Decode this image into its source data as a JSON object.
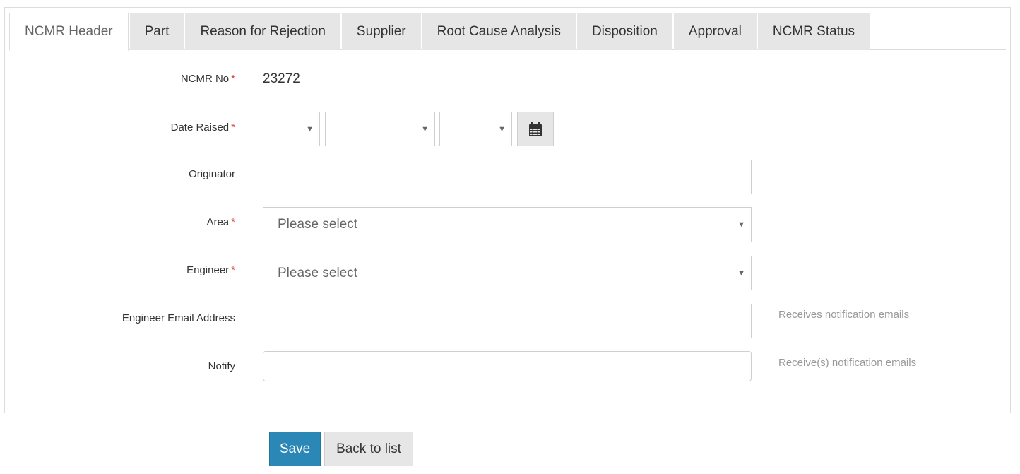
{
  "tabs": [
    {
      "label": "NCMR Header",
      "active": true
    },
    {
      "label": "Part"
    },
    {
      "label": "Reason for Rejection"
    },
    {
      "label": "Supplier"
    },
    {
      "label": "Root Cause Analysis"
    },
    {
      "label": "Disposition"
    },
    {
      "label": "Approval"
    },
    {
      "label": "NCMR Status"
    }
  ],
  "form": {
    "required_marker": "*",
    "ncmr_no": {
      "label": "NCMR No",
      "value": "23272"
    },
    "date_raised": {
      "label": "Date Raised",
      "day": "",
      "month": "",
      "year": "",
      "calendar_icon": "calendar-icon"
    },
    "originator": {
      "label": "Originator",
      "value": ""
    },
    "area": {
      "label": "Area",
      "selected": "Please select"
    },
    "engineer": {
      "label": "Engineer",
      "selected": "Please select"
    },
    "engineer_email": {
      "label": "Engineer Email Address",
      "value": "",
      "hint": "Receives notification emails"
    },
    "notify": {
      "label": "Notify",
      "value": "",
      "hint": "Receive(s) notification emails"
    }
  },
  "actions": {
    "save_label": "Save",
    "back_label": "Back to list"
  },
  "colors": {
    "primary": "#2b87b6",
    "required": "#e0403a"
  }
}
